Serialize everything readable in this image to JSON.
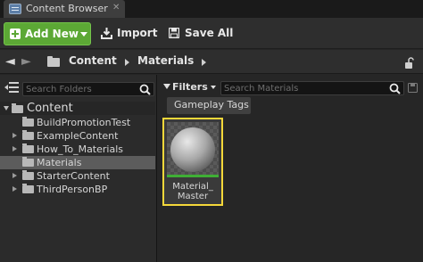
{
  "tab": {
    "title": "Content Browser",
    "close": "✕",
    "icon": "content-browser-icon"
  },
  "toolbar": {
    "add_new": "Add New",
    "import": "Import",
    "save_all": "Save All"
  },
  "path": {
    "back": "◄",
    "forward": "►",
    "crumbs": [
      "Content",
      "Materials"
    ]
  },
  "sources": {
    "search_placeholder": "Search Folders",
    "tree": [
      {
        "label": "Content",
        "arrow": "open",
        "root": true
      },
      {
        "label": "BuildPromotionTest",
        "arrow": "none"
      },
      {
        "label": "ExampleContent",
        "arrow": "closed"
      },
      {
        "label": "How_To_Materials",
        "arrow": "closed"
      },
      {
        "label": "Materials",
        "arrow": "none",
        "selected": true
      },
      {
        "label": "StarterContent",
        "arrow": "closed"
      },
      {
        "label": "ThirdPersonBP",
        "arrow": "closed"
      }
    ]
  },
  "assets": {
    "filters_label": "Filters",
    "search_placeholder": "Search Materials",
    "filter_tags": [
      "Gameplay Tags"
    ],
    "items": [
      {
        "name_line1": "Material_",
        "name_line2": "Master",
        "selected": true,
        "type_color": "#3fae35"
      }
    ]
  },
  "colors": {
    "add_new_green": "#5ca835",
    "selection_highlight": "#f5d83a",
    "selected_row": "#5c5c5c",
    "material_type": "#3fae35"
  }
}
